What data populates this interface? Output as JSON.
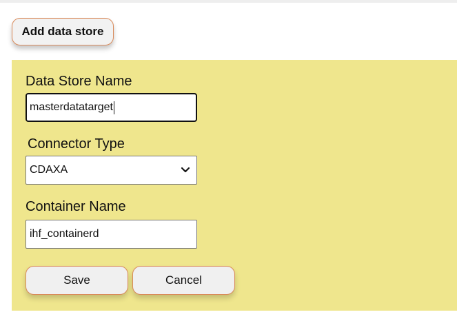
{
  "header": {
    "add_button_label": "Add data store"
  },
  "form": {
    "data_store_name": {
      "label": "Data Store Name",
      "value": "masterdatatarget"
    },
    "connector_type": {
      "label": "Connector Type",
      "selected": "CDAXA"
    },
    "container_name": {
      "label": "Container Name",
      "value": "ihf_containerd"
    },
    "save_label": "Save",
    "cancel_label": "Cancel"
  },
  "colors": {
    "panel_background": "#efe68d",
    "button_border": "#d98a5a",
    "button_background": "#f0f0f0"
  },
  "icons": {
    "select_arrow": "chevron-down-icon"
  }
}
